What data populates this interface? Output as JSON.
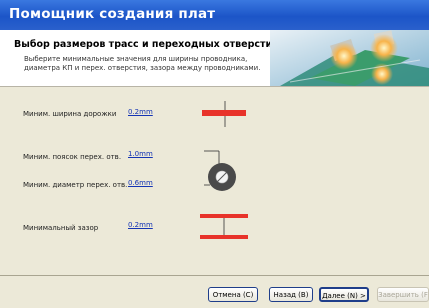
{
  "window": {
    "title": "Помощник создания плат"
  },
  "header": {
    "title": "Выбор размеров трасс и переходных отверстий",
    "subtitle": "Выберите минимальные значения для ширины проводника, диаметра КП и перех. отверстия, зазора между проводниками."
  },
  "fields": [
    {
      "label": "Миним. ширина дорожки",
      "value": "0.2mm"
    },
    {
      "label": "Миним. поясок перех. отв.",
      "value": "1.0mm"
    },
    {
      "label": "Миним. диаметр перех. отв.",
      "value": "0.6mm"
    },
    {
      "label": "Минимальный зазор",
      "value": "0.2mm"
    }
  ],
  "buttons": {
    "cancel": "Отмена (C)",
    "back": "Назад (B)",
    "next": "Далее (N) >",
    "finish": "Завершить (F"
  },
  "colors": {
    "trace": "#e8332a",
    "via": "#4a4a4a",
    "titlebar": "#2360d0"
  }
}
